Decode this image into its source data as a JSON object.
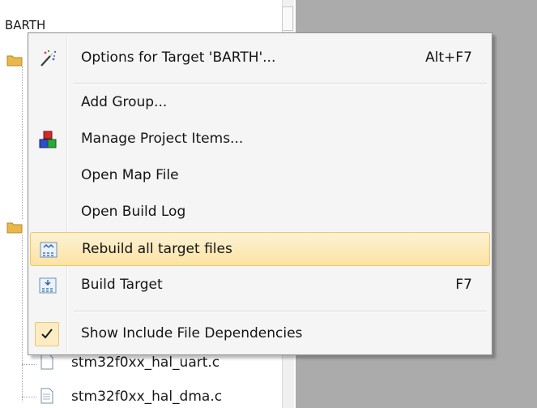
{
  "project_tree": {
    "root_label": "BARTH",
    "files": [
      "stm32f0xx_hal_uart.c",
      "stm32f0xx_hal_dma.c"
    ]
  },
  "context_menu": {
    "items": [
      {
        "label": "Options for Target 'BARTH'...",
        "shortcut": "Alt+F7",
        "icon": "magic-wand-icon"
      },
      {
        "label": "Add Group...",
        "shortcut": "",
        "icon": ""
      },
      {
        "label": "Manage Project Items...",
        "shortcut": "",
        "icon": "project-items-icon"
      },
      {
        "label": "Open Map File",
        "shortcut": "",
        "icon": ""
      },
      {
        "label": "Open Build Log",
        "shortcut": "",
        "icon": ""
      },
      {
        "label": "Rebuild all target files",
        "shortcut": "",
        "icon": "rebuild-icon"
      },
      {
        "label": "Build Target",
        "shortcut": "F7",
        "icon": "build-icon"
      },
      {
        "label": "Show Include File Dependencies",
        "shortcut": "",
        "icon": "checkmark-icon"
      }
    ],
    "highlighted_item": "Rebuild all target files"
  },
  "colors": {
    "highlight_bg": "#fbe3a3",
    "highlight_border": "#f2c662",
    "editor_area": "#ababab"
  }
}
